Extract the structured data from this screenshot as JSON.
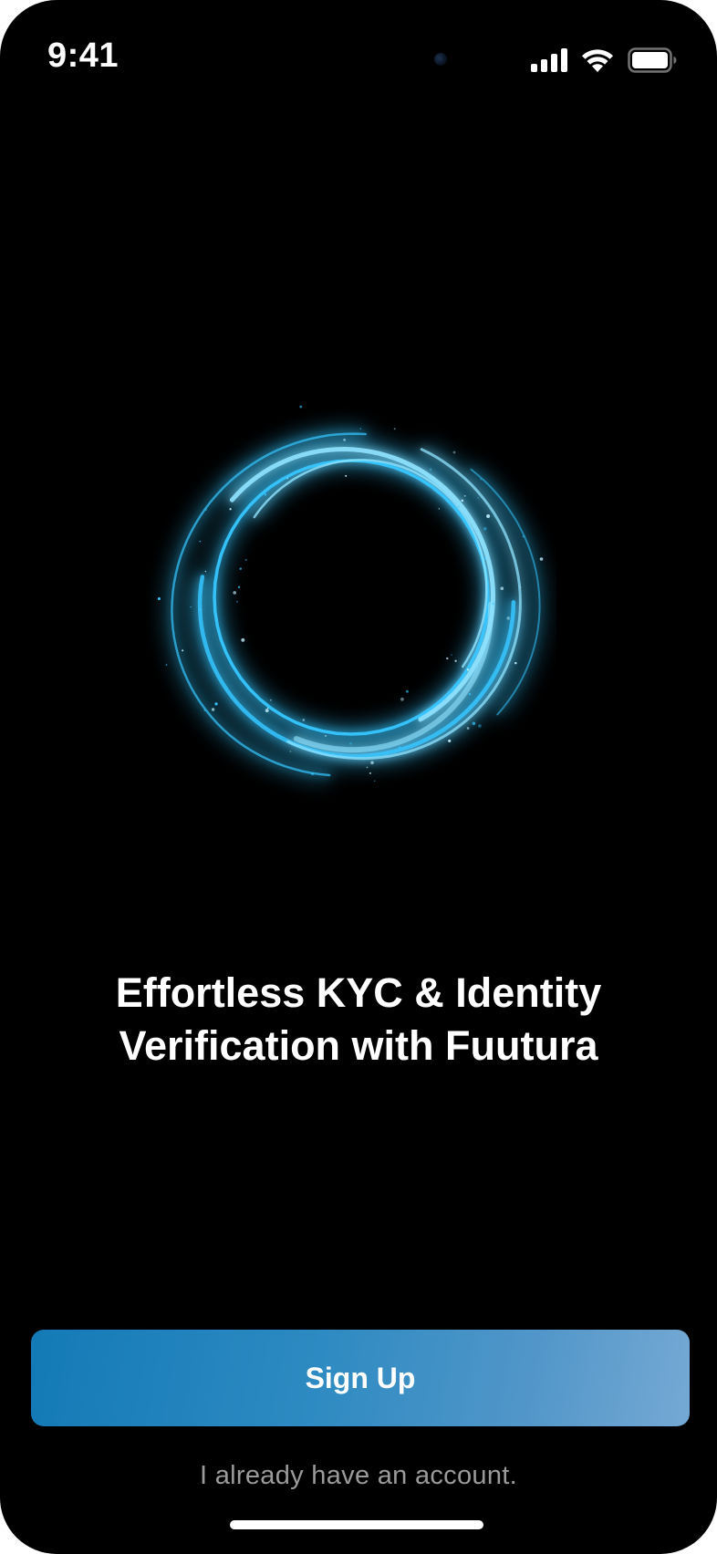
{
  "status_bar": {
    "time": "9:41",
    "icons": [
      "cellular-signal-icon",
      "wifi-icon",
      "battery-icon"
    ]
  },
  "hero": {
    "icon": "glowing-ring-icon",
    "accent_color": "#35c6ff"
  },
  "headline": {
    "line1": "Effortless KYC & Identity",
    "line2": "Verification with Fuutura"
  },
  "actions": {
    "signup_label": "Sign Up",
    "login_label": "I already have an account."
  },
  "colors": {
    "background": "#000000",
    "button_gradient_start": "#137ab6",
    "button_gradient_end": "#75a9d4",
    "secondary_text": "#9a9a9a"
  }
}
